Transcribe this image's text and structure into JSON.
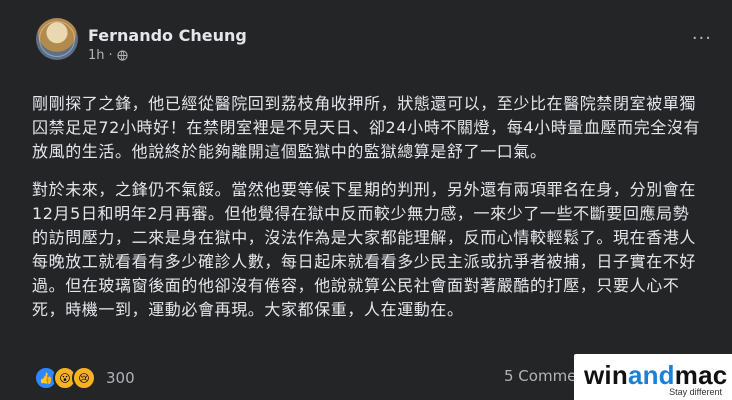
{
  "post": {
    "author": "Fernando Cheung",
    "time": "1h",
    "paragraphs": [
      "剛剛探了之鋒，他已經從醫院回到荔枝角收押所，狀態還可以，至少比在醫院禁閉室被單獨囚禁足足72小時好！在禁閉室裡是不見天日、卻24小時不關燈，每4小時量血壓而完全沒有放風的生活。他說終於能夠離開這個監獄中的監獄總算是舒了一口氣。",
      "對於未來，之鋒仍不氣餒。當然他要等候下星期的判刑，另外還有兩項罪名在身，分別會在12月5日和明年2月再審。但他覺得在獄中反而較少無力感，一來少了一些不斷要回應局勢的訪問壓力，二來是身在獄中，沒法作為是大家都能理解，反而心情較輕鬆了。現在香港人每晚放工就看看有多少確診人數，每日起床就看看多少民主派或抗爭者被捕，日子實在不好過。但在玻璃窗後面的他卻沒有倦容，他說就算公民社會面對著嚴酷的打壓，只要人心不死，時機一到，運動必會再現。大家都保重，人在運動在。"
    ],
    "reaction_count": "300",
    "comments_label": "5 Comments"
  },
  "watermark": {
    "win": "win",
    "and": "and",
    "mac": "mac",
    "tagline": "Stay different"
  },
  "icons": {
    "privacy": "globe-icon",
    "menu": "more-options-icon",
    "reactions": [
      "like-icon",
      "wow-icon",
      "sad-icon"
    ]
  },
  "colors": {
    "background": "#242526",
    "text": "#e4e6eb",
    "secondary_text": "#b0b3b8",
    "like_blue": "#2d88ff"
  }
}
